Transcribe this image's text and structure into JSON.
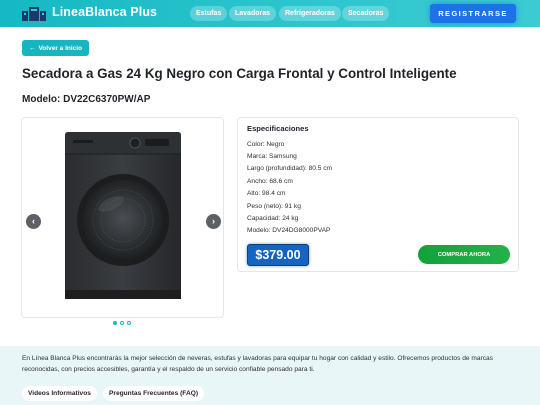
{
  "header": {
    "brand": "LineaBlanca Plus",
    "nav": [
      "Estufas",
      "Lavadoras",
      "Refrigeradoras",
      "Secadoras"
    ],
    "register_label": "REGISTRARSE",
    "colors": {
      "header_bg": "#2fc6cf",
      "register_bg": "#1e72e8"
    }
  },
  "back_label": "Volver a Inicio",
  "product": {
    "title": "Secadora a Gas 24 Kg Negro con Carga Frontal y Control Inteligente",
    "model": "Modelo: DV22C6370PW/AP",
    "carousel": {
      "prev_icon": "chevron-left-icon",
      "next_icon": "chevron-right-icon",
      "slides": 3,
      "active_slide": 1
    }
  },
  "specs": {
    "title": "Especificaciones",
    "items": [
      "Color: Negro",
      "Marca: Samsung",
      "Largo (profundidad): 80.5 cm",
      "Ancho: 68.6 cm",
      "Alto: 98.4 cm",
      "Peso (neto): 91 kg",
      "Capacidad: 24 kg",
      "Modelo: DV24DG8000PVAP"
    ],
    "price": "$379.00",
    "buy_label": "COMPRAR AHORA",
    "colors": {
      "price_bg": "#1565c0",
      "buy_bg": "#1aa842"
    }
  },
  "footer": {
    "text": "En Línea Blanca Plus encontrarás la mejor selección de neveras, estufas y lavadoras para equipar tu hogar con calidad y estilo. Ofrecemos productos de marcas reconocidas, con precios accesibles, garantía y el respaldo de un servicio confiable pensado para ti.",
    "links": [
      "Videos Informativos",
      "Preguntas Frecuentes (FAQ)"
    ]
  }
}
